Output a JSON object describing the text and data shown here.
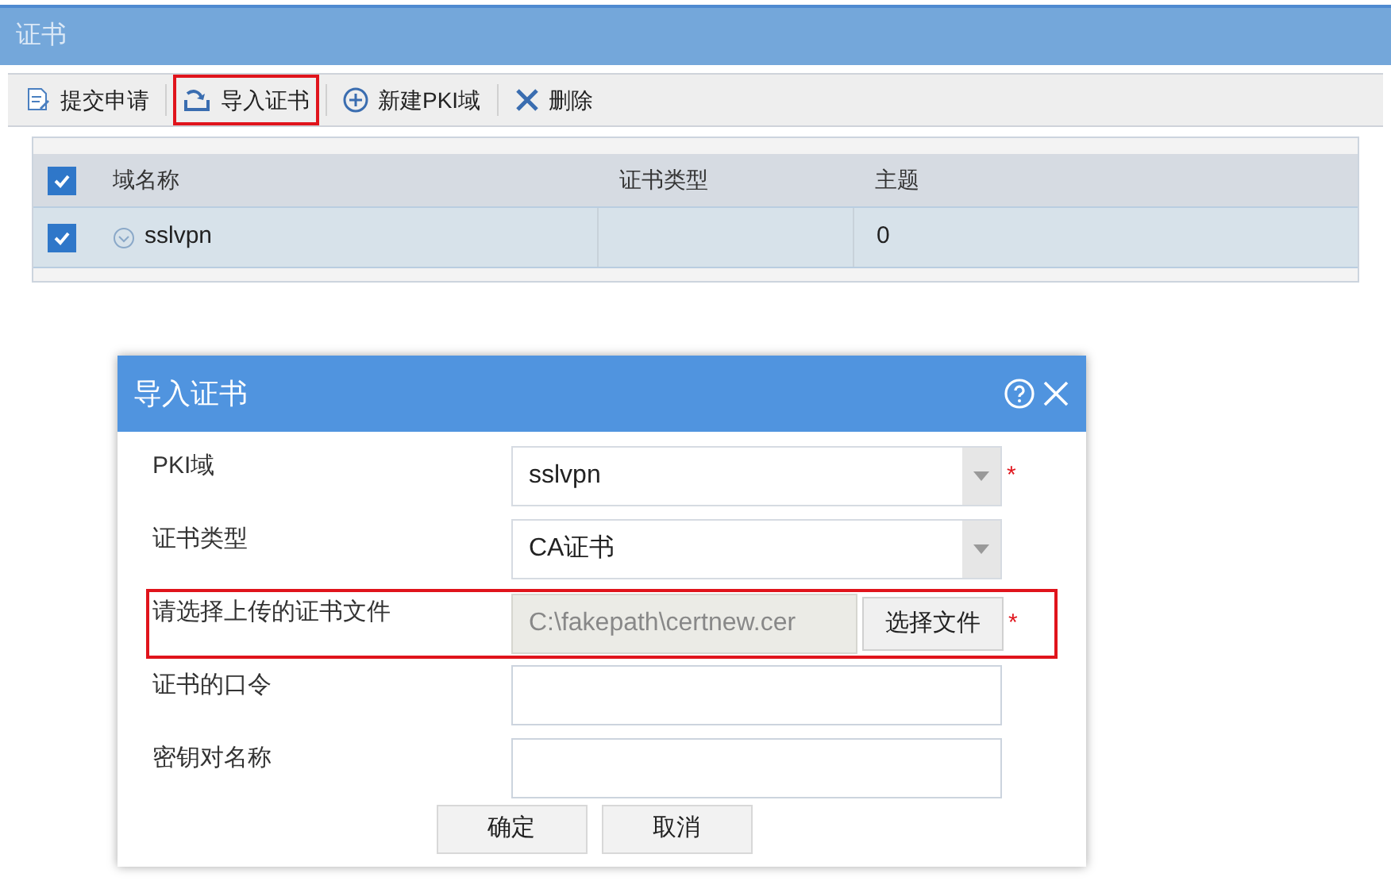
{
  "window": {
    "title": "证书"
  },
  "toolbar": [
    {
      "label": "提交申请",
      "kind": "submit",
      "highlighted": false
    },
    {
      "label": "导入证书",
      "kind": "import",
      "highlighted": true
    },
    {
      "label": "新建PKI域",
      "kind": "add",
      "highlighted": false
    },
    {
      "label": "删除",
      "kind": "delete",
      "highlighted": false
    }
  ],
  "table": {
    "all_checked": true,
    "columns": [
      "域名称",
      "证书类型",
      "主题"
    ],
    "rows": [
      {
        "checked": true,
        "cells": [
          "sslvpn",
          "",
          "0"
        ]
      }
    ]
  },
  "dialog": {
    "title": "导入证书",
    "fields": [
      {
        "label": "PKI域",
        "kind": "select",
        "value": "sslvpn",
        "required_mark": "*",
        "highlighted": false
      },
      {
        "label": "证书类型",
        "kind": "select",
        "value": "CA证书",
        "highlighted": false
      },
      {
        "label": "请选择上传的证书文件",
        "kind": "file",
        "value": "C:\\fakepath\\certnew.cer",
        "button": "选择文件",
        "required_mark": "*",
        "highlighted": true
      },
      {
        "label": "证书的口令",
        "kind": "text",
        "highlighted": false
      },
      {
        "label": "密钥对名称",
        "kind": "text",
        "highlighted": false
      }
    ],
    "buttons": [
      "确定",
      "取消"
    ]
  }
}
